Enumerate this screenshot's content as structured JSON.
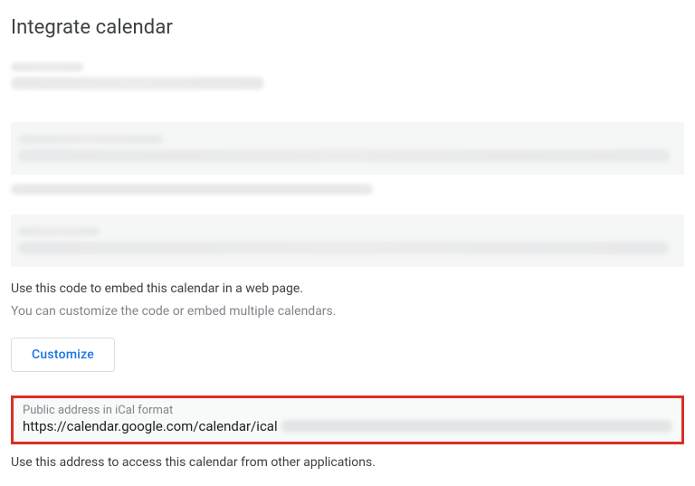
{
  "section": {
    "title": "Integrate calendar"
  },
  "embed": {
    "helper": "Use this code to embed this calendar in a web page.",
    "secondary": "You can customize the code or embed multiple calendars.",
    "customize_label": "Customize"
  },
  "ical": {
    "label": "Public address in iCal format",
    "url_visible": "https://calendar.google.com/calendar/ical",
    "footer": "Use this address to access this calendar from other applications."
  }
}
